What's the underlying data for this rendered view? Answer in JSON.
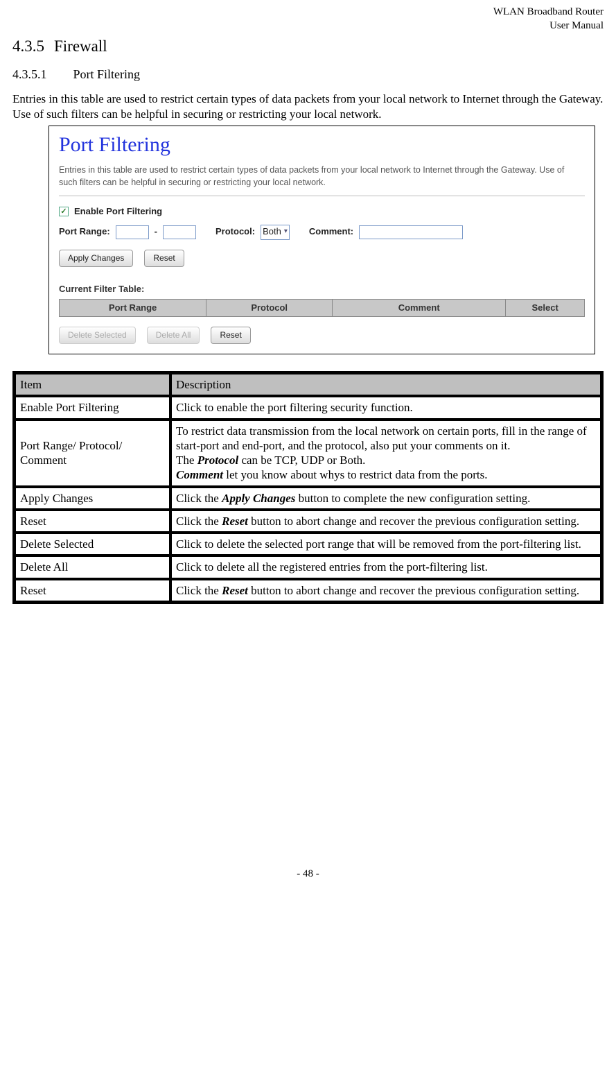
{
  "header": {
    "line1": "WLAN  Broadband  Router",
    "line2": "User  Manual"
  },
  "sec": {
    "num": "4.3.5",
    "title": "Firewall"
  },
  "sub": {
    "num": "4.3.5.1",
    "title": "Port Filtering"
  },
  "intro": "Entries in this table are used to restrict certain types of data packets from your local network to Internet through the Gateway. Use of such filters can be helpful in securing or restricting your local network.",
  "shot": {
    "title": "Port Filtering",
    "blurb": "Entries in this table are used to restrict certain types of data packets from your local network to Internet through the Gateway. Use of such filters can be helpful in securing or restricting your local network.",
    "enable_label": "Enable Port Filtering",
    "port_range_label": "Port Range:",
    "dash": "-",
    "protocol_label": "Protocol:",
    "protocol_value": "Both",
    "comment_label": "Comment:",
    "apply": "Apply Changes",
    "reset": "Reset",
    "table_title": "Current Filter Table:",
    "cols": {
      "c1": "Port Range",
      "c2": "Protocol",
      "c3": "Comment",
      "c4": "Select"
    },
    "del_sel": "Delete Selected",
    "del_all": "Delete All",
    "reset2": "Reset"
  },
  "desc": {
    "h_item": "Item",
    "h_desc": "Description",
    "rows": [
      {
        "item": "Enable Port Filtering",
        "desc_a": "Click to enable the port filtering security function."
      },
      {
        "item": "Port Range/ Protocol/ Comment",
        "desc_a": "To restrict data transmission from the local network on certain ports, fill in the range of start-port and end-port, and the protocol, also put your comments on it.",
        "desc_b_pre": "The ",
        "desc_b_em": "Protocol",
        "desc_b_post": " can be TCP, UDP or Both.",
        "desc_c_em": "Comment",
        "desc_c_post": " let you know about whys to restrict data from the ports."
      },
      {
        "item": "Apply Changes",
        "desc_a_pre": "Click the ",
        "desc_a_em": "Apply Changes",
        "desc_a_post": " button to complete the new configuration setting."
      },
      {
        "item": "Reset",
        "desc_a_pre": "Click the ",
        "desc_a_em": "Reset",
        "desc_a_post": " button to abort change and recover the previous configuration setting."
      },
      {
        "item": "Delete Selected",
        "desc_a": "Click to delete the selected port range that will be removed from the port-filtering list."
      },
      {
        "item": "Delete All",
        "desc_a": "Click to delete all the registered entries from the port-filtering list."
      },
      {
        "item": "Reset",
        "desc_a_pre": "Click the ",
        "desc_a_em": "Reset",
        "desc_a_post": " button to abort change and recover the previous configuration setting."
      }
    ]
  },
  "footer": "- 48 -"
}
